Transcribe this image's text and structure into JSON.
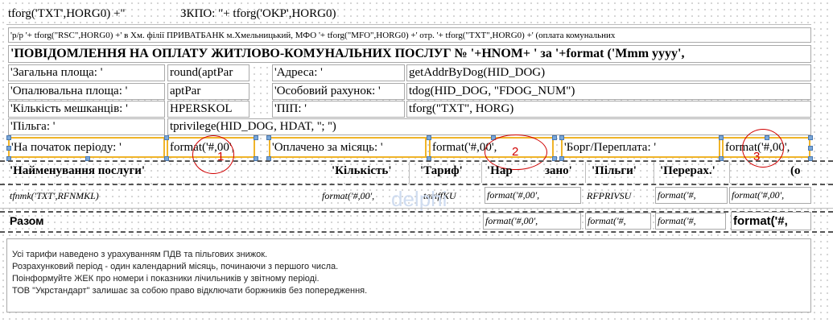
{
  "header": {
    "line1": "tforg('TXT',HORG0) +\"",
    "line1_okp": "ЗКПО: \"+ tforg('OKP',HORG0)",
    "line2": "'p/p '+ tforg(\"RSC\",HORG0) +' в Хм. філії ПРИВАТБАНК м.Хмельницький, МФО '+ tforg(\"MFO\",HORG0) +' отр. '+ tforg(\"TXT\",HORG0) +' (оплата комунальних",
    "title": "'ПОВІДОМЛЕННЯ НА ОПЛАТУ ЖИТЛОВО-КОМУНАЛЬНИХ ПОСЛУГ № '+HNOM+ ' за '+format ('Mmm yyyy',"
  },
  "info": {
    "area_label": "'Загальна площа: '",
    "area_value": "round(aptPar",
    "heated_label": "'Опалювальна площа: '",
    "heated_value": "aptPar",
    "residents_label": "'Кількість мешканців: '",
    "residents_value": "HPERSKOL",
    "privilege_label": "'Пільга: '",
    "privilege_value": "tprivilege(HID_DOG, HDAT, ''; '')",
    "address_label": "'Адреса: '",
    "address_value": "getAddrByDog(HID_DOG)",
    "account_label": "'Особовий рахунок: '",
    "account_value": "tdog(HID_DOG, \"FDOG_NUM\")",
    "pip_label": "'ПІП: '",
    "pip_value": "tforg(\"TXT\", HORG)"
  },
  "balance": {
    "start_label": "'На початок періоду: '",
    "start_value": "format('#,00',",
    "paid_label": "'Оплачено за місяць: '",
    "paid_value": "format('#,00',",
    "debt_label": "'Борг/Переплата: '",
    "debt_value": "format('#,00',"
  },
  "markers": [
    "1",
    "2",
    "3"
  ],
  "table": {
    "headers": [
      "'Найменування послуги'",
      "'Кількість'",
      "'Тариф'",
      "'Нар",
      "зано'",
      "'Пільги'",
      "'Перерах.'",
      "(о"
    ],
    "row": [
      "tfnmk('TXT',RFNMKL)",
      "format('#,00',",
      "tariffKU",
      "format('#,00',",
      "RFPRIVSU",
      "format('#,",
      "format('#,00',"
    ],
    "total_label": "Разом",
    "total_values": [
      "format('#,00',",
      "format('#,",
      "format('#,",
      "format('#,"
    ]
  },
  "watermark": "delphi",
  "notes": [
    "Усі тарифи наведено з урахуванням ПДВ та пільгових знижок.",
    "Розрахунковий період - один календарний місяць, починаючи з першого числа.",
    "Поінформуйте ЖЕК про номери і показники лічильників у звітному періоді.",
    "ТОВ \"Укрстандарт\" залишає за собою право відключати боржників без попередження."
  ]
}
